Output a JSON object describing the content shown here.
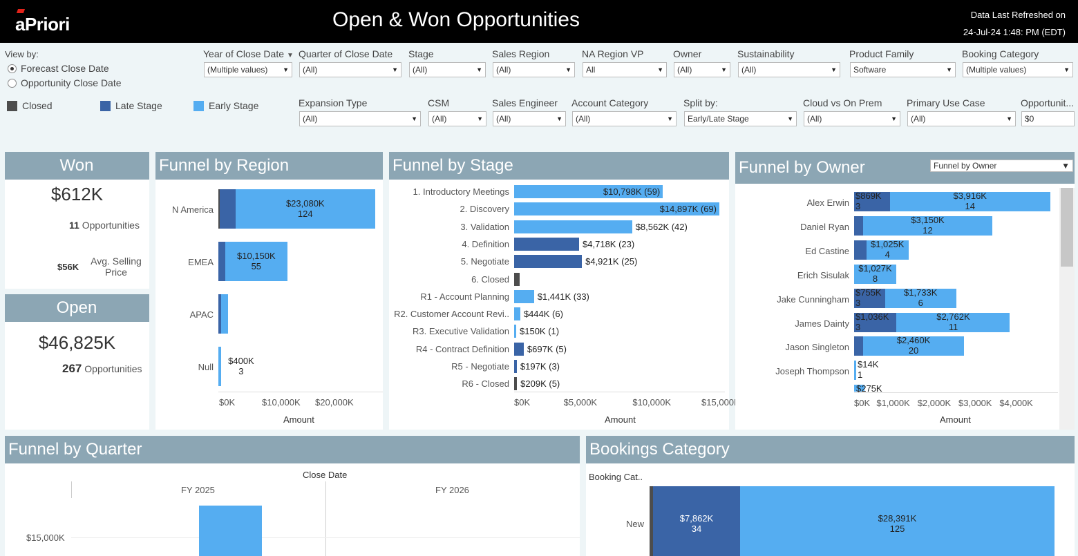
{
  "header": {
    "logo": "aPriori",
    "title": "Open & Won Opportunities",
    "refresh_label": "Data Last Refreshed on",
    "refresh_value": "24-Jul-24  1:48: PM (EDT)"
  },
  "view_by": {
    "label": "View by:",
    "options": [
      "Forecast Close Date",
      "Opportunity Close Date"
    ],
    "selected": "Forecast Close Date"
  },
  "legend": [
    "Closed",
    "Late Stage",
    "Early Stage"
  ],
  "colors": {
    "closed": "#4d4d4d",
    "late": "#3a64a6",
    "early": "#55adf1",
    "panel_head": "#8ca6b4"
  },
  "filters_row1": [
    {
      "label": "Year of Close Date",
      "value": "(Multiple values)"
    },
    {
      "label": "Quarter of Close Date",
      "value": "(All)"
    },
    {
      "label": "Stage",
      "value": "(All)"
    },
    {
      "label": "Sales Region",
      "value": "(All)"
    },
    {
      "label": "NA Region VP",
      "value": "All"
    },
    {
      "label": "Owner",
      "value": "(All)"
    },
    {
      "label": "Sustainability",
      "value": "(All)"
    },
    {
      "label": "Product Family",
      "value": "Software"
    },
    {
      "label": "Booking Category",
      "value": "(Multiple values)"
    }
  ],
  "filters_row2": [
    {
      "label": "Expansion Type",
      "value": "(All)"
    },
    {
      "label": "CSM",
      "value": "(All)"
    },
    {
      "label": "Sales Engineer",
      "value": "(All)"
    },
    {
      "label": "Account Category",
      "value": "(All)"
    },
    {
      "label": "Split by:",
      "value": "Early/Late Stage"
    },
    {
      "label": "Cloud vs On Prem",
      "value": "(All)"
    },
    {
      "label": "Primary Use Case",
      "value": "(All)"
    },
    {
      "label": "Opportunit...",
      "value": "$0"
    }
  ],
  "won": {
    "title": "Won",
    "amount": "$612K",
    "count": "11",
    "count_label": "Opportunities",
    "asp": "$56K",
    "asp_label_1": "Avg. Selling",
    "asp_label_2": "Price"
  },
  "open": {
    "title": "Open",
    "amount": "$46,825K",
    "count": "267",
    "count_label": "Opportunities"
  },
  "region": {
    "title": "Funnel by Region",
    "axis_title": "Amount",
    "ticks": [
      "$0K",
      "$10,000K",
      "$20,000K"
    ],
    "rows": [
      {
        "label": "N America",
        "closed": 200,
        "late": 2300,
        "early": 20580,
        "text1": "$23,080K",
        "text2": "124"
      },
      {
        "label": "EMEA",
        "closed": 0,
        "late": 1000,
        "early": 9150,
        "text1": "$10,150K",
        "text2": "55"
      },
      {
        "label": "APAC",
        "closed": 0,
        "late": 450,
        "early": 950,
        "text1": "",
        "text2": ""
      },
      {
        "label": "Null",
        "closed": 0,
        "late": 0,
        "early": 400,
        "text1": "$400K",
        "text2": "3"
      }
    ]
  },
  "stage": {
    "title": "Funnel by Stage",
    "axis_title": "Amount",
    "ticks": [
      "$0K",
      "$5,000K",
      "$10,000K",
      "$15,000K"
    ],
    "rows": [
      {
        "label": "1. Introductory Meetings",
        "value": 10798,
        "kind": "early",
        "text": "$10,798K (59)"
      },
      {
        "label": "2. Discovery",
        "value": 14897,
        "kind": "early",
        "text": "$14,897K (69)"
      },
      {
        "label": "3. Validation",
        "value": 8562,
        "kind": "early",
        "text": "$8,562K (42)"
      },
      {
        "label": "4. Definition",
        "value": 4718,
        "kind": "late",
        "text": "$4,718K (23)"
      },
      {
        "label": "5. Negotiate",
        "value": 4921,
        "kind": "late",
        "text": "$4,921K (25)"
      },
      {
        "label": "6. Closed",
        "value": 400,
        "kind": "closed",
        "text": ""
      },
      {
        "label": "R1 - Account Planning",
        "value": 1441,
        "kind": "early",
        "text": "$1,441K (33)"
      },
      {
        "label": "R2. Customer Account Revi..",
        "value": 444,
        "kind": "early",
        "text": "$444K (6)"
      },
      {
        "label": "R3. Executive Validation",
        "value": 150,
        "kind": "early",
        "text": "$150K (1)"
      },
      {
        "label": "R4 - Contract Definition",
        "value": 697,
        "kind": "late",
        "text": "$697K (5)"
      },
      {
        "label": "R5 - Negotiate",
        "value": 197,
        "kind": "late",
        "text": "$197K (3)"
      },
      {
        "label": "R6 - Closed",
        "value": 209,
        "kind": "closed",
        "text": "$209K (5)"
      }
    ]
  },
  "owner": {
    "title": "Funnel by Owner",
    "selector": "Funnel by Owner",
    "axis_title": "Amount",
    "ticks": [
      "$0K",
      "$1,000K",
      "$2,000K",
      "$3,000K",
      "$4,000K"
    ],
    "rows": [
      {
        "label": "Alex Erwin",
        "late": 869,
        "early": 3916,
        "late_t1": "$869K",
        "late_t2": "3",
        "early_t1": "$3,916K",
        "early_t2": "14"
      },
      {
        "label": "Daniel Ryan",
        "late": 220,
        "early": 3150,
        "late_t1": "",
        "late_t2": "",
        "early_t1": "$3,150K",
        "early_t2": "12"
      },
      {
        "label": "Ed Castine",
        "late": 300,
        "early": 1025,
        "late_t1": "",
        "late_t2": "",
        "early_t1": "$1,025K",
        "early_t2": "4"
      },
      {
        "label": "Erich Sisulak",
        "late": 0,
        "early": 1027,
        "late_t1": "",
        "late_t2": "",
        "early_t1": "$1,027K",
        "early_t2": "8"
      },
      {
        "label": "Jake Cunningham",
        "late": 755,
        "early": 1733,
        "late_t1": "$755K",
        "late_t2": "3",
        "early_t1": "$1,733K",
        "early_t2": "6"
      },
      {
        "label": "James Dainty",
        "late": 1036,
        "early": 2762,
        "late_t1": "$1,036K",
        "late_t2": "3",
        "early_t1": "$2,762K",
        "early_t2": "11"
      },
      {
        "label": "Jason Singleton",
        "late": 220,
        "early": 2460,
        "late_t1": "",
        "late_t2": "",
        "early_t1": "$2,460K",
        "early_t2": "20"
      },
      {
        "label": "Joseph Thompson",
        "late": 0,
        "early": 14,
        "late_t1": "",
        "late_t2": "",
        "early_t1": "$14K",
        "early_t2": "1"
      },
      {
        "label": "",
        "late": 0,
        "early": 275,
        "late_t1": "",
        "late_t2": "",
        "early_t1": "$275K",
        "early_t2": ""
      }
    ]
  },
  "quarter": {
    "title": "Funnel by Quarter",
    "header": "Close Date",
    "years": [
      "FY 2025",
      "FY 2026"
    ],
    "ytick": "$15,000K"
  },
  "bookings": {
    "title": "Bookings Category",
    "col_header": "Booking Cat..",
    "row_label": "New",
    "late_t1": "$7,862K",
    "late_t2": "34",
    "early_t1": "$28,391K",
    "early_t2": "125"
  }
}
